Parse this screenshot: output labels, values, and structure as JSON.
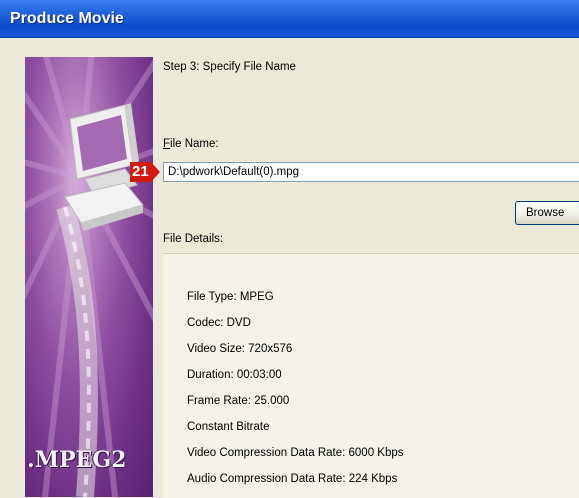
{
  "window": {
    "title": "Produce Movie"
  },
  "side_image": {
    "caption": ".MPEG2"
  },
  "step": {
    "label": "Step 3: Specify File Name"
  },
  "file_name": {
    "label_accesskey": "F",
    "label_rest": "ile Name:",
    "value": "D:\\pdwork\\Default(0).mpg"
  },
  "annotation": {
    "number": "21",
    "color": "#d01a10"
  },
  "browse_button": {
    "label": "Browse"
  },
  "file_details": {
    "label": "File Details:",
    "items": [
      "File Type: MPEG",
      "Codec: DVD",
      "Video Size: 720x576",
      "Duration: 00:03:00",
      "Frame Rate: 25.000",
      "Constant Bitrate",
      "Video Compression Data Rate: 6000 Kbps",
      "Audio Compression Data Rate: 224 Kbps"
    ]
  },
  "colors": {
    "titlebar": "#0b4bc9",
    "window_bg": "#ece9d8",
    "side_image_purple": "#8e4fa0"
  }
}
